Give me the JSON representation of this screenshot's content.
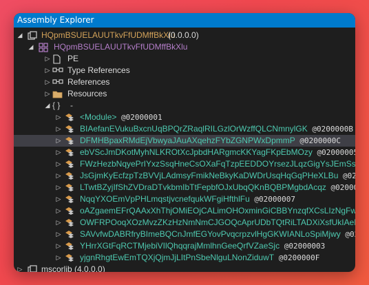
{
  "window": {
    "title": "Assembly Explorer"
  },
  "colors": {
    "titlebar": "#007acc",
    "background": "#1e1e1e",
    "assembly_text": "#d4a35a",
    "module_text": "#b47ec9",
    "type_text": "#4ec9b0",
    "selected_row": "#3f3f46"
  },
  "tree": {
    "assembly": {
      "name": "HQpmBSUELAUUTkvFfUDMffBkXlu",
      "version": "(0.0.0.0)"
    },
    "module": {
      "name": "HQpmBSUELAUUTkvFfUDMffBkXlu"
    },
    "folders": [
      {
        "label": "PE",
        "icon": "pe-file-icon"
      },
      {
        "label": "Type References",
        "icon": "type-references-icon"
      },
      {
        "label": "References",
        "icon": "references-icon"
      },
      {
        "label": "Resources",
        "icon": "folder-icon"
      }
    ],
    "namespace": {
      "braces": "{ }",
      "name": "-"
    },
    "types": [
      {
        "name": "<Module>",
        "token": "@02000001"
      },
      {
        "name": "BIAefanEVukuBxcnUqBPQrZRaqlRILGzlOrWzffQLCNmnylGK",
        "token": "@0200000B"
      },
      {
        "name": "DFMHBpaxRMdEjVbwyaJAuAXqehzFYbZGNPWxDpmmP",
        "token": "@0200000C"
      },
      {
        "name": "ebVScJmDKotMyhNLKROtXcJpbdHARgmcKKYagFKpEbMOzy",
        "token": "@02000005"
      },
      {
        "name": "FWzHezbNqyePrIYxzSsqHneCsOXaFqTzpEEDDOYrsezJLqzGigYsJEmSsxPQ",
        "token": "@0"
      },
      {
        "name": "JsGjmKyEcfzpTzBVVjLAdmsyFmikNeBkyKaDWDrUsqHqGqPHeXLBu",
        "token": "@0200000"
      },
      {
        "name": "LTwtBZyjIfShZVDraDTvkbmIbTtFepbfOJxUbqQKnBQBPMgbdAcqz",
        "token": "@0200007"
      },
      {
        "name": "NqqYXOEmVpPHLmqstjvcnefqukWFgiHfthlFu",
        "token": "@02000007"
      },
      {
        "name": "oAZgaemEFrQAAxXhThjOMiEOjCALimOHOxminGiCBBYnzqfXCsLIzNgFwKw",
        "token": ""
      },
      {
        "name": "OWFRPOoqXOzMvzZKzHzNmNmCJGOQcAprUDbTQtRiLTADXiXsfUkIAeMBj",
        "token": ""
      },
      {
        "name": "SAVvfwDABRfryBImeBQCnJmfEGYovPvqcrpzvlHgGKWIANLoSpiMjwy",
        "token": "@0200"
      },
      {
        "name": "YHrrXGtFqRCTMjebiVIlQhqqrajMmlhnGeeQrfVZaeSjc",
        "token": "@02000003"
      },
      {
        "name": "yjgnRhgtEwEmTQXjQjmJjLItPnSbeNlguLNonZiduwT",
        "token": "@0200000F"
      }
    ],
    "next_assembly": {
      "name": "mscorlib",
      "version": "(4.0.0.0)"
    }
  }
}
